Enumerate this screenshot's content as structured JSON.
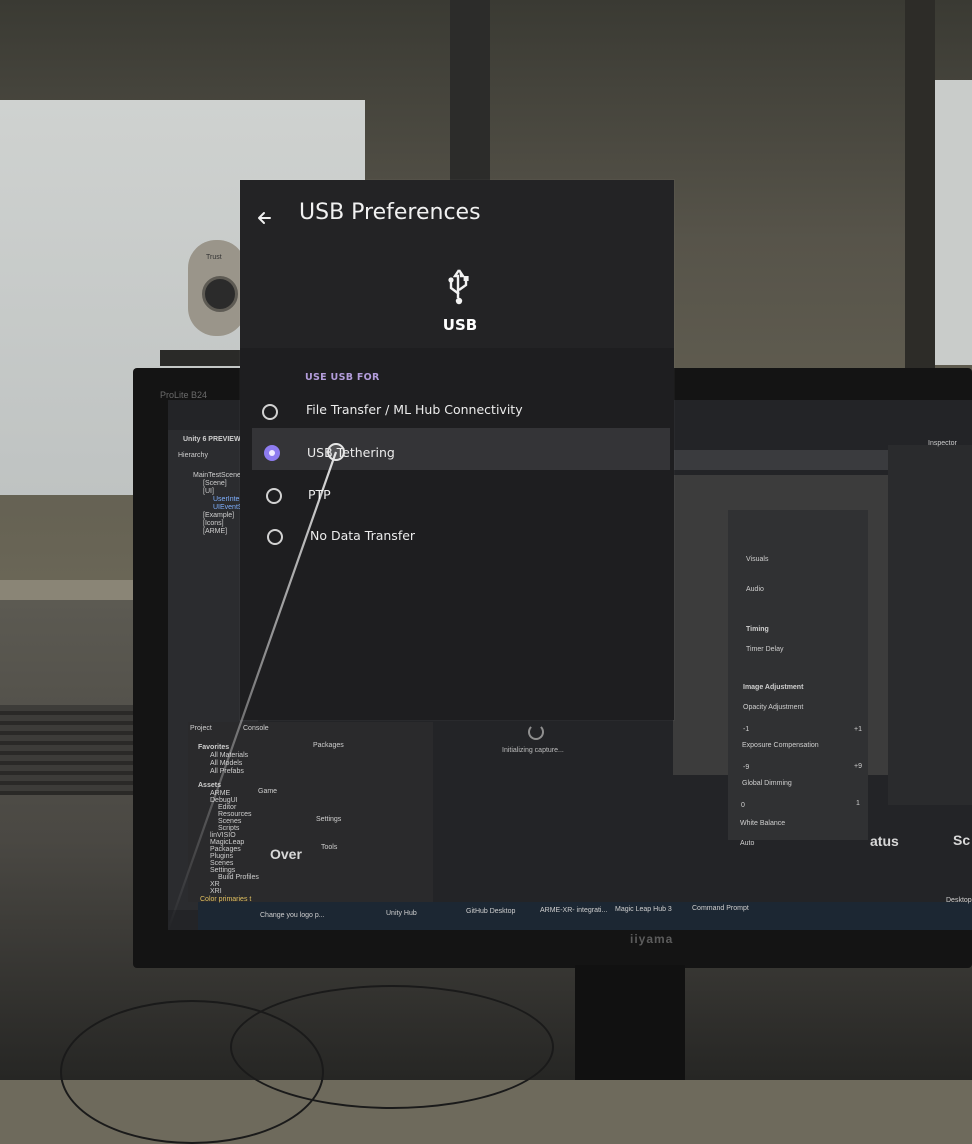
{
  "header": {
    "back_icon": "arrow-left-icon",
    "title": "USB Preferences"
  },
  "usb": {
    "icon": "usb-icon",
    "label": "USB"
  },
  "section": {
    "label": "USE USB FOR"
  },
  "options": [
    {
      "label": "File Transfer / ML Hub Connectivity",
      "selected": false
    },
    {
      "label": "USB Tethering",
      "selected": true
    },
    {
      "label": "PTP",
      "selected": false
    },
    {
      "label": "No Data Transfer",
      "selected": false
    }
  ],
  "colors": {
    "accent": "#8e7cf0",
    "section_label": "#b39ddb",
    "panel_bg": "#1e1e20"
  },
  "background": {
    "monitor_brand": "iiyama",
    "loading_text": "Initializing capture...",
    "hierarchy_title": "Hierarchy",
    "unity_title": "Unity 6 PREVIEW",
    "scene_items": [
      "MainTestScene",
      "[Scene]",
      "[UI]",
      "UserInterface",
      "UIEventSystem",
      "[Example]",
      "[Icons]",
      "[ARME]"
    ],
    "project_tab": "Project",
    "console_tab": "Console",
    "favorites_label": "Favorites",
    "favorites_items": [
      "All Materials",
      "All Models",
      "All Prefabs"
    ],
    "assets_label": "Assets",
    "asset_items": [
      "ARME",
      "DebugUI",
      "Editor",
      "Resources",
      "Scenes",
      "Scripts",
      "linVISIO",
      "MagicLeap",
      "Packages",
      "Plugins",
      "Scenes",
      "Settings",
      "Build Profiles",
      "XR",
      "XRI"
    ],
    "side_labels": [
      "Packages",
      "Settings",
      "Tools"
    ],
    "game_label": "Game",
    "over_text": "Over",
    "status_text": "atus",
    "sc_text": "Sc",
    "inspector_label": "Inspector",
    "inspector_items": [
      "Visuals",
      "Audio",
      "Timing",
      "Timer Delay",
      "Image Adjustment",
      "Opacity Adjustment",
      "Exposure Compensation",
      "Global Dimming",
      "White Balance"
    ],
    "inspector_values": [
      "-1",
      "+1",
      "-9",
      "+9",
      "0",
      "1",
      "Auto"
    ],
    "taskbar_items": [
      "Change you logo p...",
      "Unity Hub",
      "GitHub Desktop",
      "ARME-XR- integrati...",
      "Magic Leap Hub 3",
      "Command Prompt"
    ],
    "warning_text": "Color primaries t",
    "desktop_text": "Desktop",
    "webcam_brand": "Trust",
    "other_monitor_text": "ProLite B24"
  }
}
